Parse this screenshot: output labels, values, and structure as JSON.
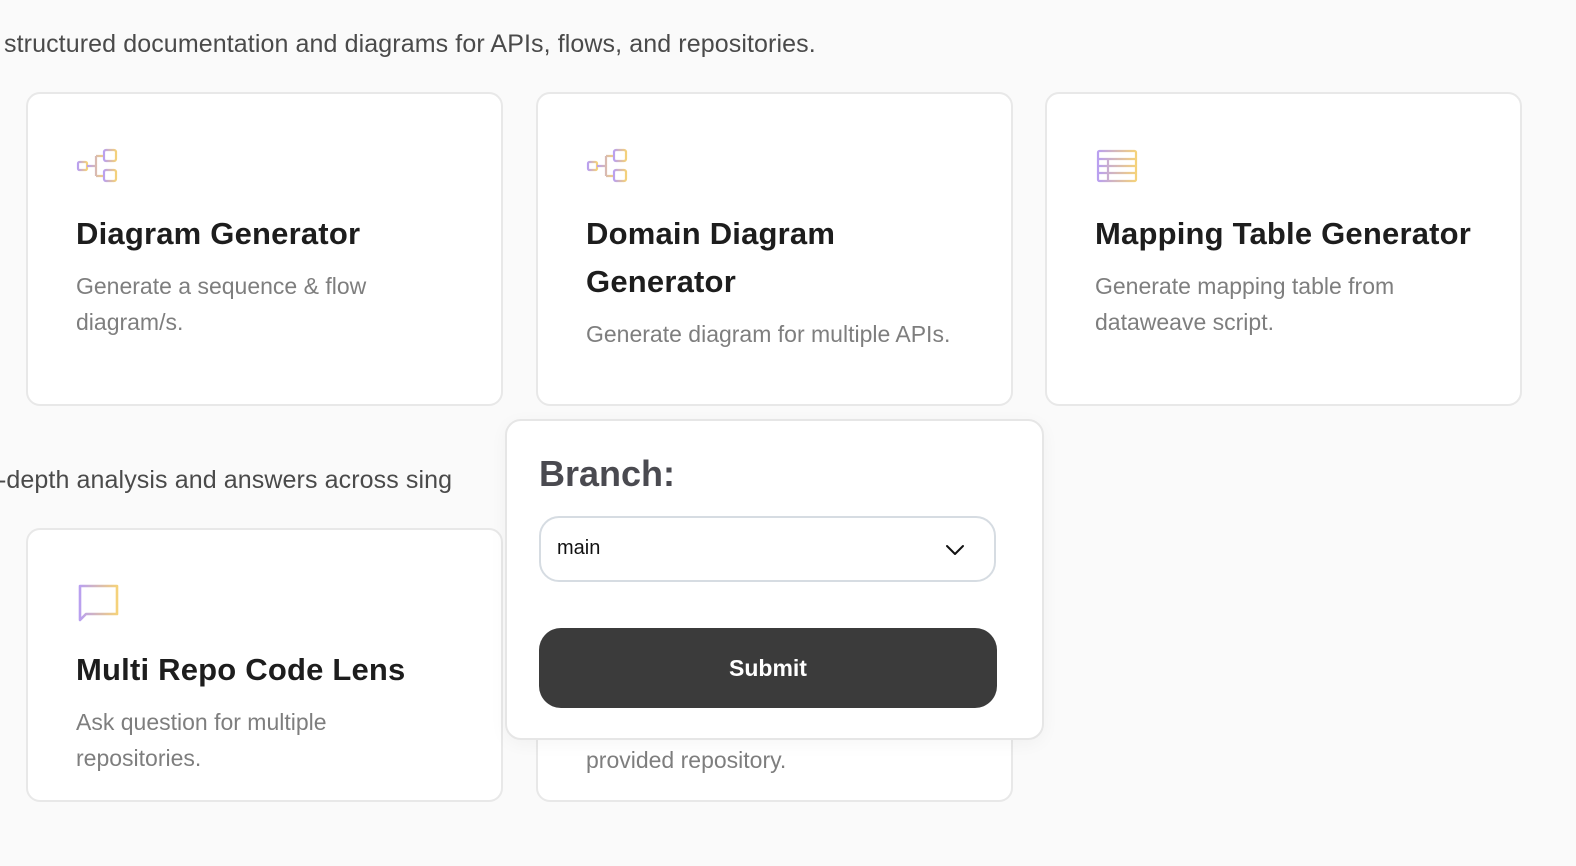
{
  "sections": {
    "documentation_desc": "structured documentation and diagrams for APIs, flows, and repositories.",
    "analysis_desc": "-depth analysis and answers across sing"
  },
  "cards": [
    {
      "icon": "flow-diagram-icon",
      "title": "Diagram Generator",
      "desc": "Generate a sequence & flow diagram/s."
    },
    {
      "icon": "flow-diagram-icon",
      "title": "Domain Diagram Generator",
      "desc": "Generate diagram for multiple APIs."
    },
    {
      "icon": "table-icon",
      "title": "Mapping Table Generator",
      "desc": "Generate mapping table from dataweave script."
    },
    {
      "icon": "chat-bubble-icon",
      "title": "Multi Repo Code Lens",
      "desc": "Ask question for multiple repositories."
    },
    {
      "desc": "provided repository."
    }
  ],
  "branch_dialog": {
    "label": "Branch:",
    "selected_branch": "main",
    "submit_label": "Submit"
  },
  "colors": {
    "icon_gradient_start": "#b9a0f0",
    "icon_gradient_end": "#f5d27a",
    "submit_bg": "#3b3b3b"
  }
}
